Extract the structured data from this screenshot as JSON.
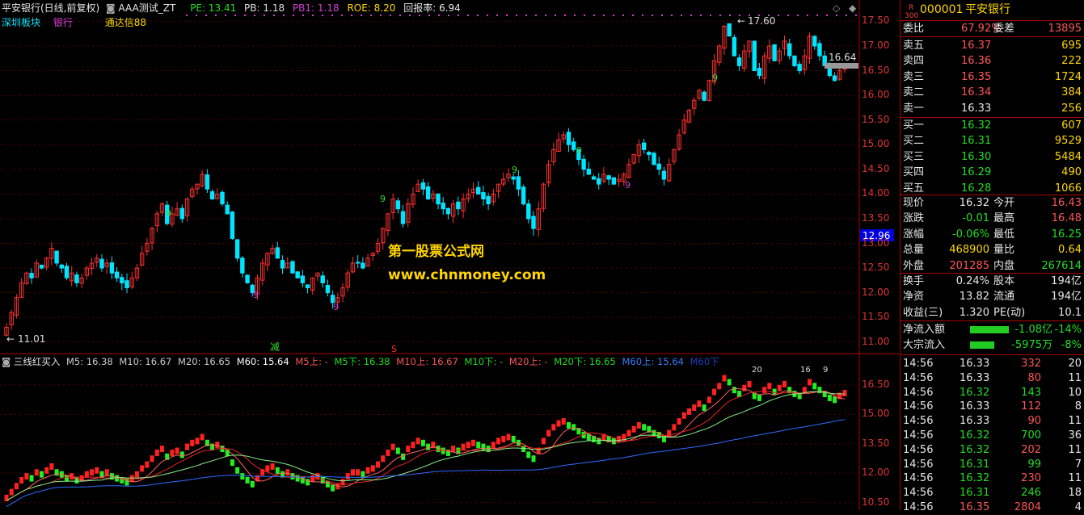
{
  "colors": {
    "up": "#ff3030",
    "down": "#00e5ff",
    "vol_up": "#ff2020",
    "vol_down": "#22ee22",
    "grid": "#5a0000",
    "ma_slow": "#2f6bff"
  },
  "header": {
    "title": "平安银行(日线,前复权)",
    "indicator": "AAA测试_ZT",
    "pe": "PE: 13.41",
    "pb": "PB: 1.18",
    "pb1": "PB1: 1.18",
    "roe": "ROE: 8.20",
    "payback": "回报率: 6.94",
    "board": "深圳板块",
    "sector": "银行",
    "tdx": "通达信88"
  },
  "watermark": {
    "line1": "第一股票公式网",
    "line2": "www.chnmoney.com"
  },
  "main_chart": {
    "y_ticks": [
      "17.50",
      "17.00",
      "16.50",
      "16.00",
      "15.50",
      "15.00",
      "14.50",
      "14.00",
      "13.50",
      "13.00",
      "12.50",
      "12.00",
      "11.50",
      "11.00"
    ],
    "current_price_tag": "12.96",
    "high_label": "17.60",
    "low_label": "11.01",
    "last_label": "16.64",
    "nine_marks": [
      "9",
      "9",
      "9",
      "9",
      "9",
      "9",
      "9",
      "9"
    ],
    "signal_reduce": "减",
    "signal_s": "S"
  },
  "chart_data": {
    "type": "candlestick",
    "ylim": [
      10.8,
      17.85
    ],
    "closes": [
      11.3,
      11.6,
      11.9,
      12.2,
      12.4,
      12.3,
      12.6,
      12.5,
      12.7,
      12.9,
      12.6,
      12.5,
      12.3,
      12.4,
      12.2,
      12.3,
      12.5,
      12.6,
      12.7,
      12.5,
      12.6,
      12.4,
      12.3,
      12.2,
      12.1,
      12.3,
      12.5,
      12.8,
      13.0,
      13.3,
      13.6,
      13.8,
      13.4,
      13.6,
      13.7,
      13.5,
      13.9,
      14.1,
      14.2,
      14.4,
      14.1,
      13.9,
      14.0,
      13.8,
      13.6,
      13.1,
      12.7,
      12.4,
      12.2,
      12.0,
      12.3,
      12.6,
      12.8,
      12.9,
      12.7,
      12.5,
      12.6,
      12.4,
      12.3,
      12.2,
      12.1,
      12.3,
      12.4,
      12.2,
      12.0,
      11.8,
      11.9,
      12.1,
      12.4,
      12.6,
      12.6,
      12.5,
      12.7,
      12.8,
      13.0,
      13.3,
      13.6,
      13.9,
      13.7,
      13.4,
      13.8,
      14.0,
      14.2,
      14.1,
      13.9,
      14.0,
      13.8,
      13.7,
      13.6,
      13.8,
      13.7,
      13.9,
      14.0,
      14.1,
      14.0,
      13.9,
      13.8,
      14.0,
      14.2,
      14.3,
      14.4,
      14.3,
      14.1,
      13.8,
      13.5,
      13.3,
      13.7,
      14.2,
      14.6,
      14.9,
      15.1,
      15.2,
      15.0,
      14.9,
      14.7,
      14.5,
      14.4,
      14.3,
      14.2,
      14.4,
      14.3,
      14.2,
      14.3,
      14.4,
      14.6,
      14.8,
      15.0,
      14.9,
      14.8,
      14.6,
      14.5,
      14.3,
      14.6,
      14.9,
      15.2,
      15.5,
      15.7,
      15.9,
      16.1,
      15.9,
      16.3,
      16.7,
      17.0,
      17.4,
      17.2,
      16.8,
      16.6,
      16.9,
      17.1,
      16.5,
      16.4,
      16.8,
      17.0,
      16.7,
      16.9,
      17.1,
      16.8,
      16.6,
      16.5,
      16.8,
      17.2,
      17.0,
      16.8,
      16.6,
      16.4,
      16.3,
      16.5,
      16.64
    ],
    "volume_ma": {
      "M5": "16.38",
      "M10": "16.67",
      "M20": "16.65",
      "M60": "15.64"
    }
  },
  "sub_chart": {
    "title": "三线红买入",
    "m5": "M5: 16.38",
    "m10": "M10: 16.67",
    "m20": "M20: 16.65",
    "m60": "M60: 15.64",
    "m5_up": "M5上: -",
    "m5_down": "M5下: 16.38",
    "m10_up": "M10上: 16.67",
    "m10_down": "M10下: -",
    "m20_up": "M20上: -",
    "m20_down": "M20下: 16.65",
    "m60_up": "M60上: 15.64",
    "m60_down": "M60下",
    "y_ticks": [
      "16.50",
      "15.00",
      "13.50",
      "12.00",
      "10.50"
    ],
    "top_marks": [
      "20",
      "16",
      "9"
    ]
  },
  "panel": {
    "code": "000001",
    "name": "平安银行",
    "rating_r": "R",
    "rating_num": "300",
    "webi_label": "委比",
    "webi": "67.92%",
    "wecha_label": "委差",
    "wecha": "13895",
    "asks": [
      {
        "label": "卖五",
        "price": "16.37",
        "vol": "695"
      },
      {
        "label": "卖四",
        "price": "16.36",
        "vol": "222"
      },
      {
        "label": "卖三",
        "price": "16.35",
        "vol": "1724"
      },
      {
        "label": "卖二",
        "price": "16.34",
        "vol": "384"
      },
      {
        "label": "卖一",
        "price": "16.33",
        "vol": "256"
      }
    ],
    "bids": [
      {
        "label": "买一",
        "price": "16.32",
        "vol": "607"
      },
      {
        "label": "买二",
        "price": "16.31",
        "vol": "9529"
      },
      {
        "label": "买三",
        "price": "16.30",
        "vol": "5484"
      },
      {
        "label": "买四",
        "price": "16.29",
        "vol": "490"
      },
      {
        "label": "买五",
        "price": "16.28",
        "vol": "1066"
      }
    ],
    "stats": [
      {
        "l1": "现价",
        "v1": "16.32",
        "l2": "今开",
        "v2": "16.43"
      },
      {
        "l1": "涨跌",
        "v1": "-0.01",
        "l2": "最高",
        "v2": "16.48"
      },
      {
        "l1": "涨幅",
        "v1": "-0.06%",
        "l2": "最低",
        "v2": "16.25"
      },
      {
        "l1": "总量",
        "v1": "468900",
        "l2": "量比",
        "v2": "0.64"
      },
      {
        "l1": "外盘",
        "v1": "201285",
        "l2": "内盘",
        "v2": "267614"
      }
    ],
    "fin": [
      {
        "l1": "换手",
        "v1": "0.24%",
        "l2": "股本",
        "v2": "194亿"
      },
      {
        "l1": "净资",
        "v1": "13.82",
        "l2": "流通",
        "v2": "194亿"
      },
      {
        "l1": "收益(三)",
        "v1": "1.320",
        "l2": "PE(动)",
        "v2": "10.1"
      }
    ],
    "flows": [
      {
        "label": "净流入额",
        "value": "-1.08亿",
        "pct": "-14%"
      },
      {
        "label": "大宗流入",
        "value": "-5975万",
        "pct": "-8%"
      }
    ],
    "ticks": [
      {
        "time": "14:56",
        "price": "16.33",
        "vol": "332",
        "n": "20",
        "pc": "wht",
        "vc": "red"
      },
      {
        "time": "14:56",
        "price": "16.33",
        "vol": "80",
        "n": "11",
        "pc": "wht",
        "vc": "red"
      },
      {
        "time": "14:56",
        "price": "16.32",
        "vol": "143",
        "n": "10",
        "pc": "grn",
        "vc": "grn"
      },
      {
        "time": "14:56",
        "price": "16.33",
        "vol": "112",
        "n": "8",
        "pc": "wht",
        "vc": "red"
      },
      {
        "time": "14:56",
        "price": "16.33",
        "vol": "90",
        "n": "11",
        "pc": "wht",
        "vc": "red"
      },
      {
        "time": "14:56",
        "price": "16.32",
        "vol": "700",
        "n": "36",
        "pc": "grn",
        "vc": "grn"
      },
      {
        "time": "14:56",
        "price": "16.32",
        "vol": "202",
        "n": "11",
        "pc": "grn",
        "vc": "red"
      },
      {
        "time": "14:56",
        "price": "16.31",
        "vol": "99",
        "n": "7",
        "pc": "grn",
        "vc": "grn"
      },
      {
        "time": "14:56",
        "price": "16.32",
        "vol": "230",
        "n": "11",
        "pc": "grn",
        "vc": "red"
      },
      {
        "time": "14:56",
        "price": "16.31",
        "vol": "246",
        "n": "18",
        "pc": "grn",
        "vc": "grn"
      },
      {
        "time": "14:56",
        "price": "16.35",
        "vol": "2804",
        "n": "4",
        "pc": "red",
        "vc": "red"
      }
    ]
  }
}
